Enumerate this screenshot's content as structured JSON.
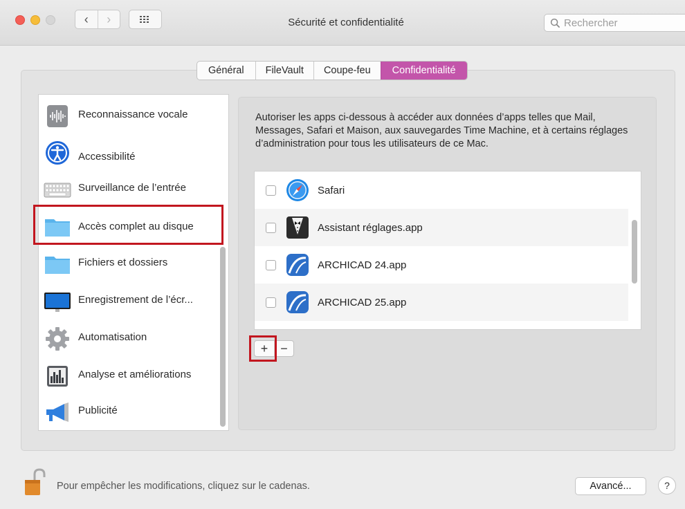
{
  "window": {
    "title": "Sécurité et confidentialité",
    "search_placeholder": "Rechercher"
  },
  "tabs": [
    {
      "label": "Général",
      "active": false
    },
    {
      "label": "FileVault",
      "active": false
    },
    {
      "label": "Coupe-feu",
      "active": false
    },
    {
      "label": "Confidentialité",
      "active": true
    }
  ],
  "sidebar": {
    "items": [
      {
        "label": "Reconnaissance vocale",
        "icon": "waveform-icon"
      },
      {
        "label": "Accessibilité",
        "icon": "accessibility-icon"
      },
      {
        "label": "Surveillance de l’entrée",
        "icon": "keyboard-icon"
      },
      {
        "label": "Accès complet au disque",
        "icon": "folder-icon",
        "selected": true
      },
      {
        "label": "Fichiers et dossiers",
        "icon": "folder-icon"
      },
      {
        "label": "Enregistrement de l’écr...",
        "icon": "display-icon"
      },
      {
        "label": "Automatisation",
        "icon": "gear-icon"
      },
      {
        "label": "Analyse et améliorations",
        "icon": "bar-chart-icon"
      },
      {
        "label": "Publicité",
        "icon": "megaphone-icon"
      }
    ]
  },
  "content": {
    "description": "Autoriser les apps ci-dessous à accéder aux données d’apps telles que Mail, Messages, Safari et Maison, aux sauvegardes Time Machine, et à certains réglages d’administration pour tous les utilisateurs de ce Mac.",
    "apps": [
      {
        "label": "Safari",
        "checked": false,
        "icon": "safari-icon"
      },
      {
        "label": "Assistant réglages.app",
        "checked": false,
        "icon": "tuxedo-icon"
      },
      {
        "label": "ARCHICAD 24.app",
        "checked": false,
        "icon": "archicad-icon"
      },
      {
        "label": "ARCHICAD 25.app",
        "checked": false,
        "icon": "archicad-icon"
      }
    ],
    "add_label": "+",
    "remove_label": "−"
  },
  "footer": {
    "lock_text": "Pour empêcher les modifications, cliquez sur le cadenas.",
    "advanced_label": "Avancé...",
    "help_label": "?"
  },
  "colors": {
    "accent_tab": "#c355aa",
    "highlight_red": "#c2161f"
  }
}
